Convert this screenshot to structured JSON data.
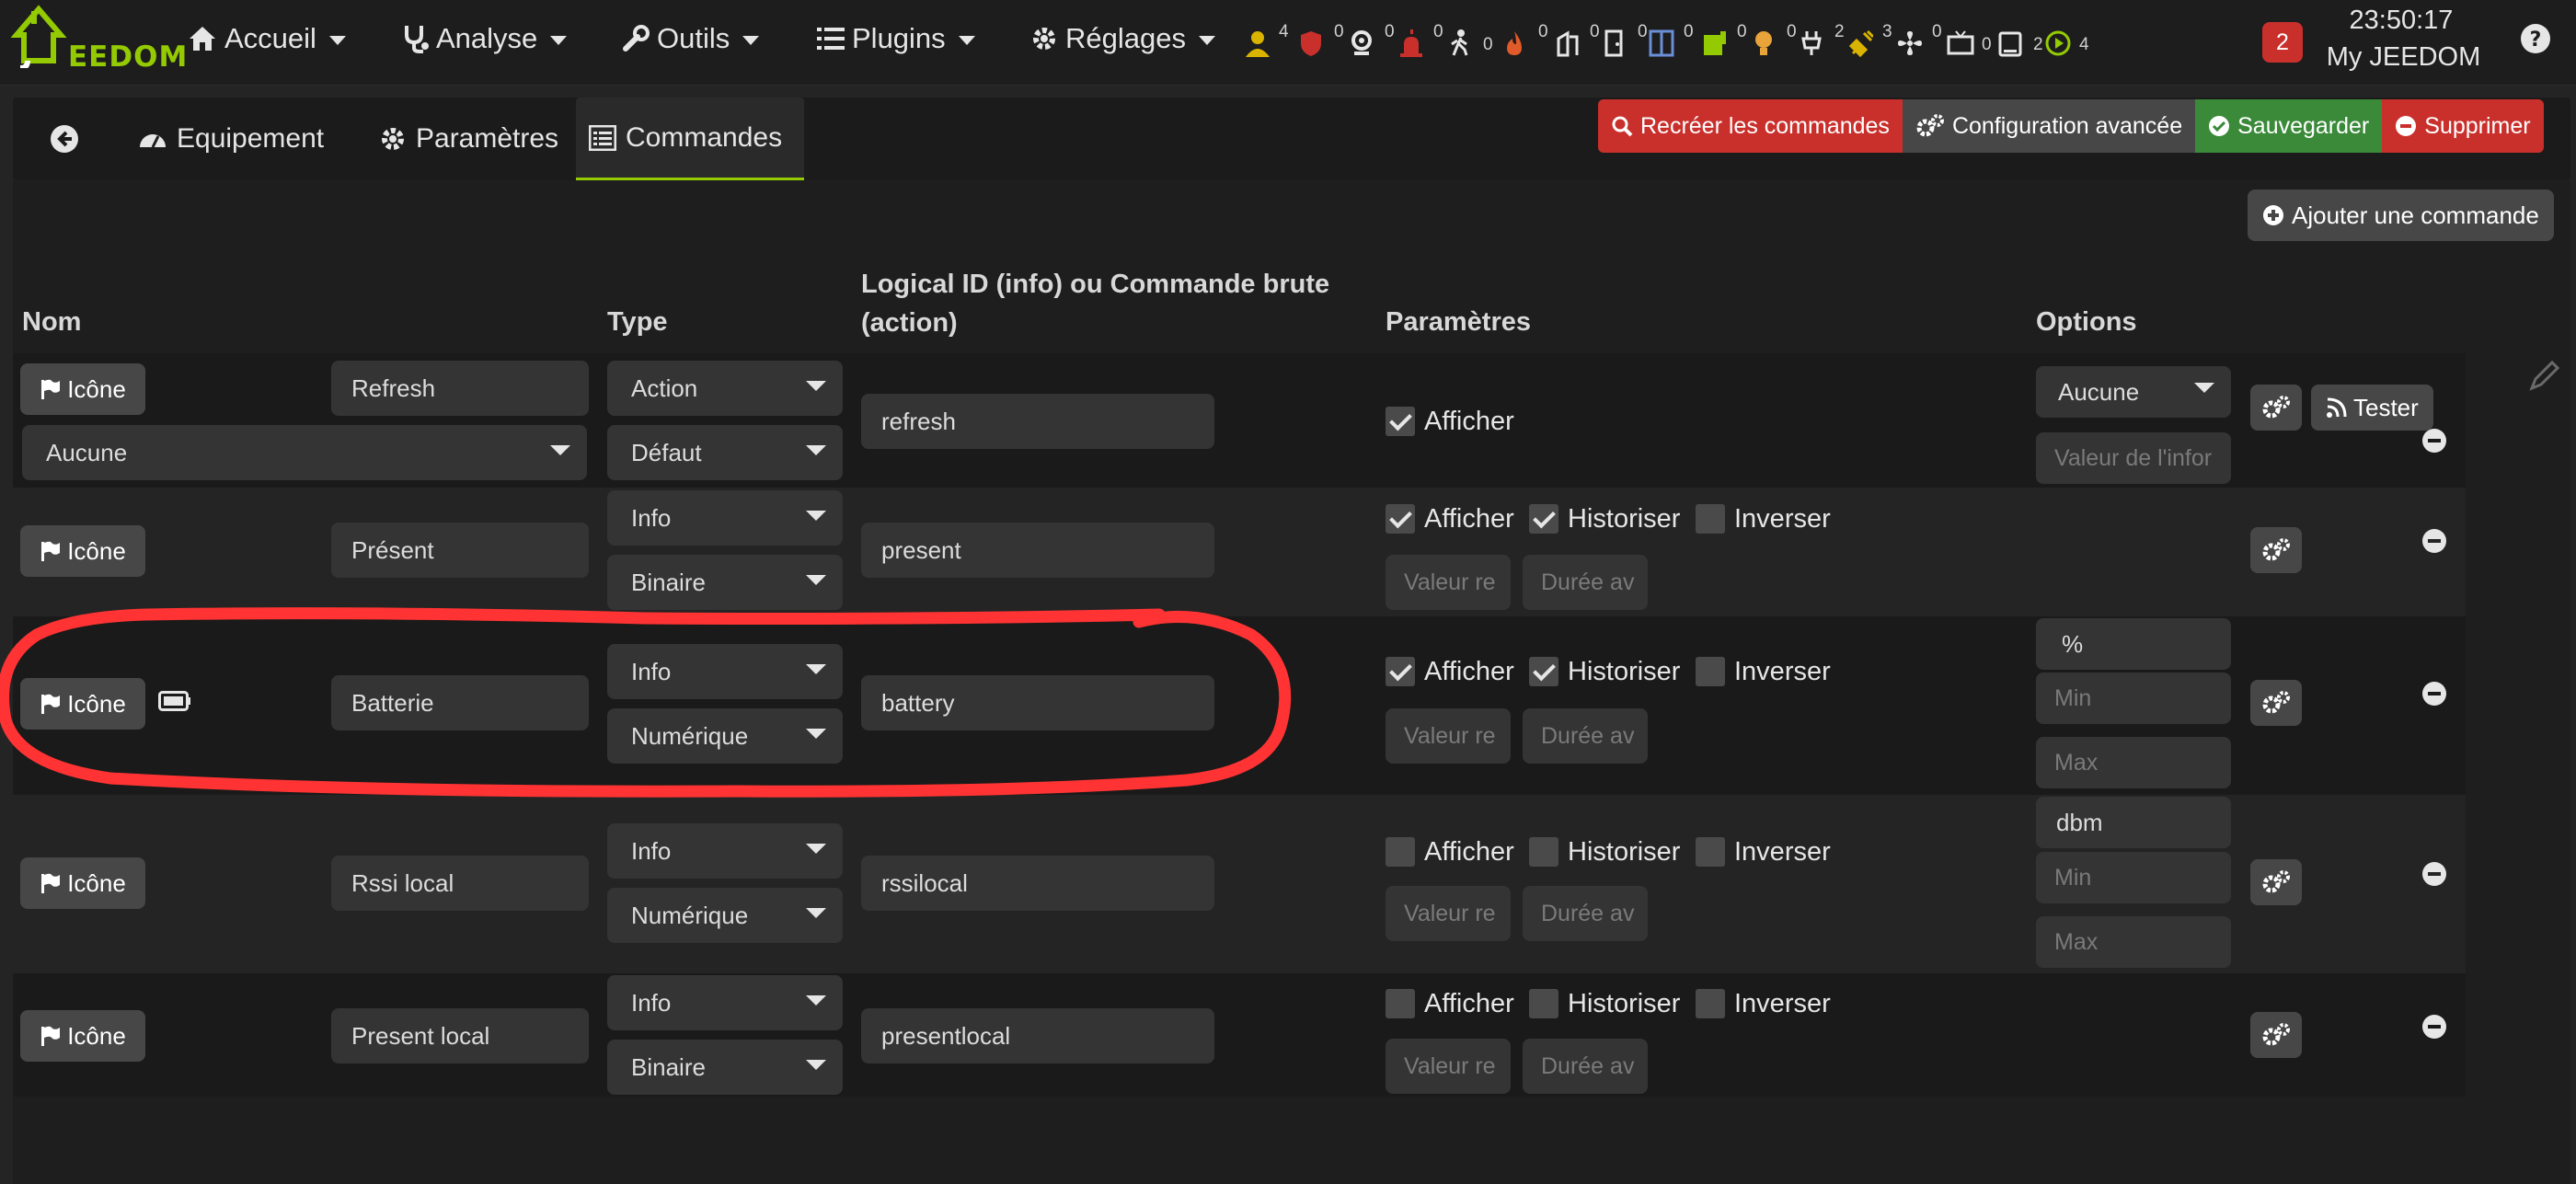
{
  "nav": {
    "logo_text": "EEDOM",
    "menus": [
      "Accueil",
      "Analyse",
      "Outils",
      "Plugins",
      "Réglages"
    ],
    "status_counts": [
      "4",
      "0",
      "0",
      "0",
      "0",
      "0",
      "0",
      "0",
      "0",
      "0",
      "0",
      "2",
      "3",
      "0",
      "0",
      "2",
      "4"
    ],
    "messages_count": "2",
    "clock": "23:50:17",
    "jeedom_name": "My JEEDOM"
  },
  "tabs": [
    "Equipement",
    "Paramètres",
    "Commandes"
  ],
  "actions": {
    "recreate": "Recréer les commandes",
    "advanced": "Configuration avancée",
    "save": "Sauvegarder",
    "delete": "Supprimer",
    "add_command": "Ajouter une commande"
  },
  "table": {
    "headers": {
      "nom": "Nom",
      "type": "Type",
      "logical": "Logical ID (info) ou Commande brute (action)",
      "params": "Paramètres",
      "options": "Options"
    },
    "icone_label": "Icône",
    "labels": {
      "afficher": "Afficher",
      "historiser": "Historiser",
      "inverser": "Inverser",
      "tester": "Tester",
      "valeur_placeholder": "Valeur re",
      "duree_placeholder": "Durée av",
      "info_placeholder": "Valeur de l'infor",
      "min_placeholder": "Min",
      "max_placeholder": "Max"
    },
    "rows": [
      {
        "name": "Refresh",
        "link": "Aucune",
        "type": "Action",
        "subtype": "Défaut",
        "logical": "refresh",
        "afficher": true,
        "option": "Aucune"
      },
      {
        "name": "Présent",
        "type": "Info",
        "subtype": "Binaire",
        "logical": "present",
        "afficher": true,
        "historiser": true,
        "inverser": false
      },
      {
        "name": "Batterie",
        "type": "Info",
        "subtype": "Numérique",
        "logical": "battery",
        "afficher": true,
        "historiser": true,
        "inverser": false,
        "unit": "%"
      },
      {
        "name": "Rssi local",
        "type": "Info",
        "subtype": "Numérique",
        "logical": "rssilocal",
        "afficher": false,
        "historiser": false,
        "inverser": false,
        "unit": "dbm"
      },
      {
        "name": "Present local",
        "type": "Info",
        "subtype": "Binaire",
        "logical": "presentlocal",
        "afficher": false,
        "historiser": false,
        "inverser": false
      }
    ]
  },
  "colors": {
    "accent": "#94ca02",
    "danger": "#c9302c",
    "success": "#3a8a3a",
    "annotation": "#ff3333"
  }
}
